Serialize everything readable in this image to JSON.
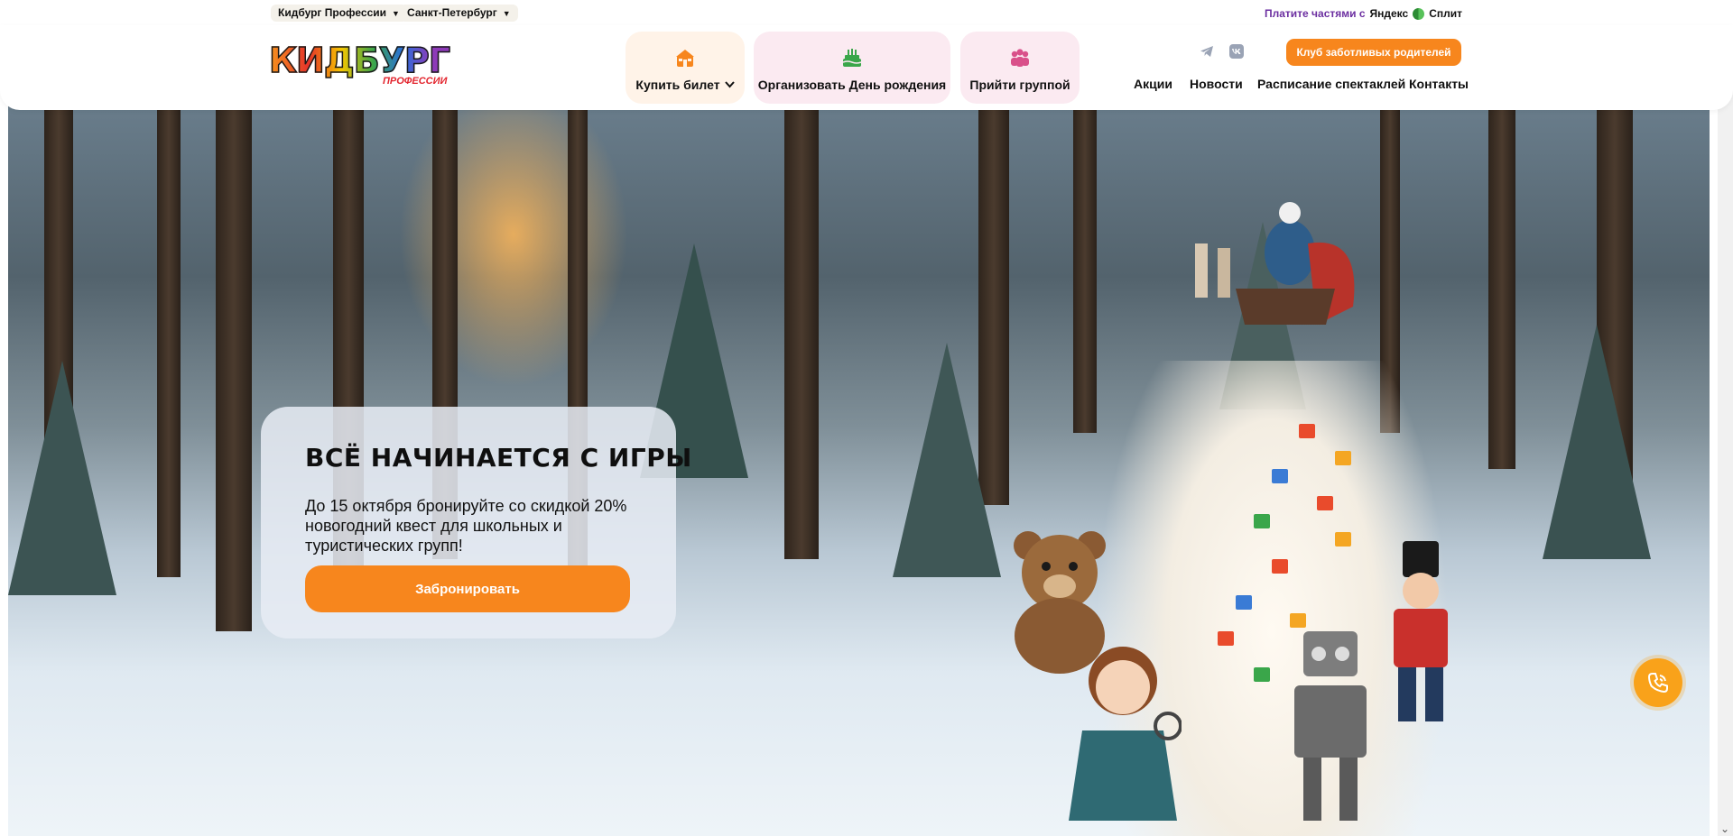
{
  "topbar": {
    "brand_select": "Кидбург Профессии",
    "city_select": "Санкт-Петербург",
    "split_lead": "Платите частями с",
    "split_brand_a": "Яндекс",
    "split_brand_b": "Сплит"
  },
  "logo": {
    "word": "КИДБУРГ",
    "sub": "ПРОФЕССИИ"
  },
  "nav_cards": {
    "buy": "Купить билет",
    "birthday": "Организовать День рождения",
    "group": "Прийти группой"
  },
  "header": {
    "club_button": "Клуб заботливых родителей",
    "menu": [
      "Акции",
      "Новости",
      "Расписание спектаклей",
      "Контакты"
    ]
  },
  "promo": {
    "title": "ВСЁ НАЧИНАЕТСЯ С ИГРЫ",
    "text": "До 15 октября бронируйте со скидкой 20% новогодний квест для школьных и туристических групп!",
    "button": "Забронировать"
  },
  "icons": {
    "buy": "ticket-house-icon",
    "birthday": "birthday-cake-icon",
    "group": "people-group-icon",
    "telegram": "telegram-icon",
    "vk": "vk-icon",
    "call": "phone-icon"
  },
  "colors": {
    "accent": "#f7861d",
    "split_purple": "#6b2ea0",
    "card_peach": "#fff3e8",
    "card_pink": "#fbeaf1",
    "call_button": "#f9a21a"
  }
}
